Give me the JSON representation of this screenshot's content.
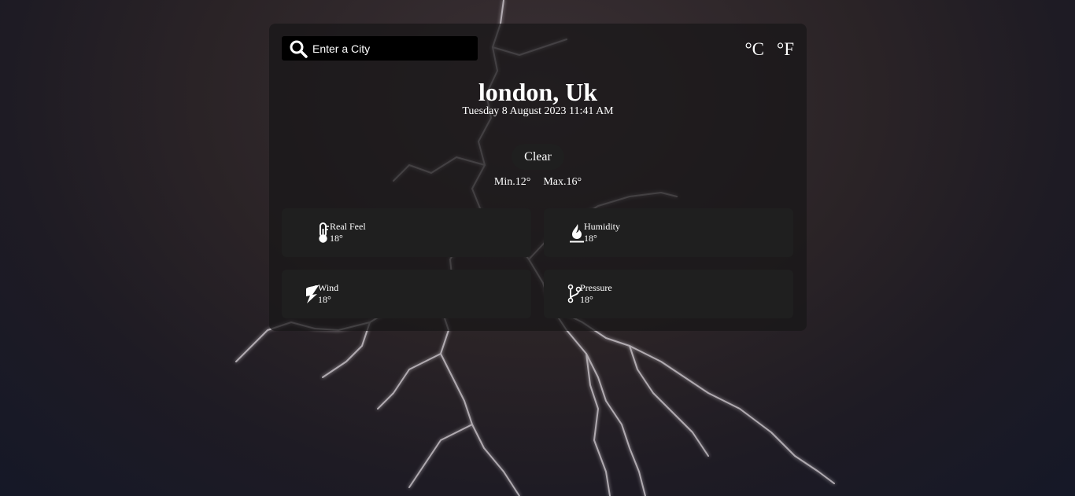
{
  "search": {
    "placeholder": "Enter a City"
  },
  "units": {
    "celsius": "°C",
    "fahrenheit": "°F"
  },
  "location": {
    "city": "london, Uk",
    "datetime": "Tuesday 8 August 2023 11:41 AM"
  },
  "weather": {
    "condition": "Clear",
    "min": "Min.12°",
    "max": "Max.16°"
  },
  "details": [
    {
      "label": "Real Feel",
      "value": "18°",
      "icon": "thermometer-icon"
    },
    {
      "label": "Humidity",
      "value": "18°",
      "icon": "humidity-drop-icon"
    },
    {
      "label": "Wind",
      "value": "18°",
      "icon": "wind-icon"
    },
    {
      "label": "Pressure",
      "value": "18°",
      "icon": "pressure-icon"
    }
  ]
}
